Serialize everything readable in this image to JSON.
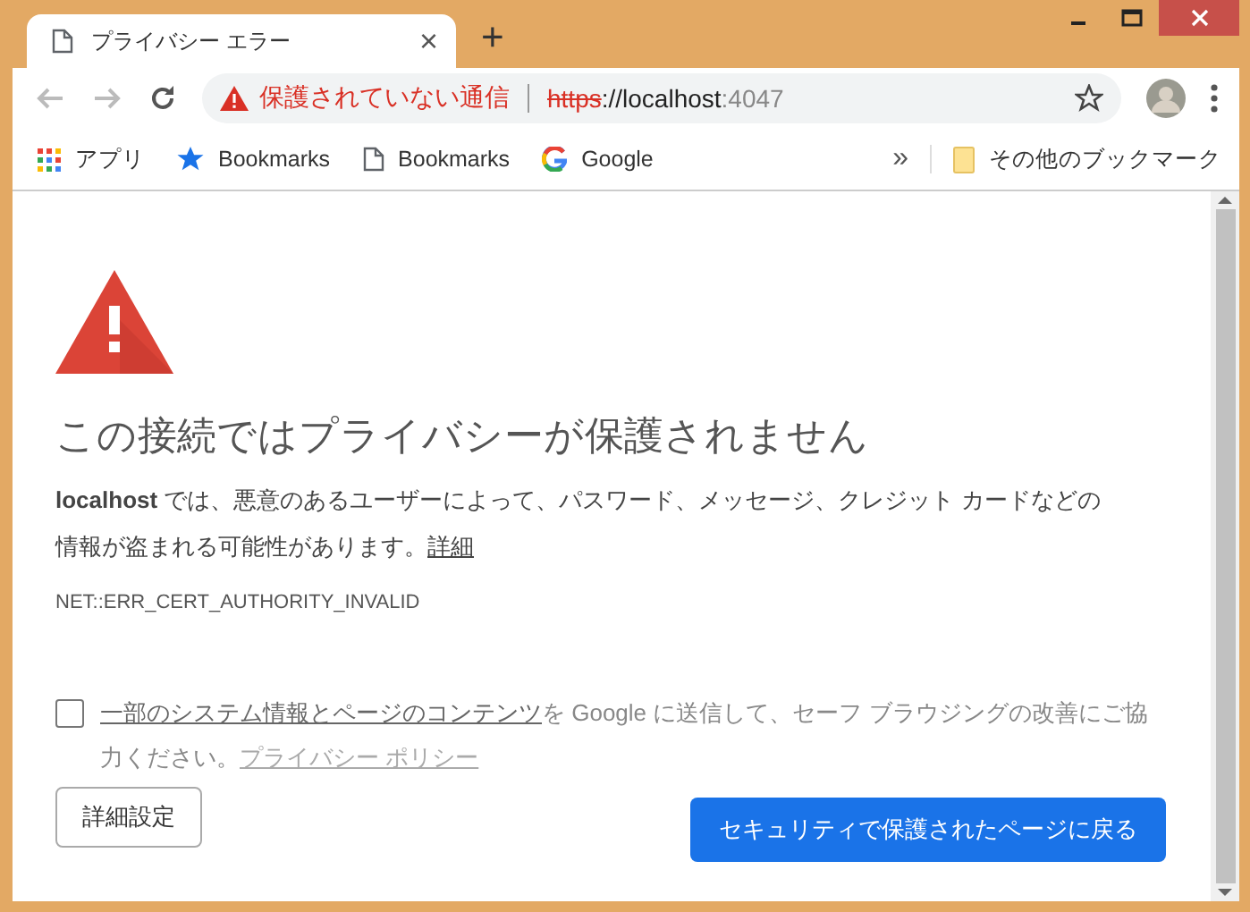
{
  "window": {
    "controls": [
      {
        "kind": "minimize"
      },
      {
        "kind": "maximize"
      },
      {
        "kind": "close"
      }
    ]
  },
  "tabs": [
    {
      "title": "プライバシー エラー",
      "close": "×",
      "selected": true
    }
  ],
  "new_tab": "+",
  "address_bar": {
    "security_label": "保護されていない通信",
    "url_scheme": "https",
    "url_host": "://localhost",
    "url_port": ":4047"
  },
  "bookmarks": [
    {
      "kind": "apps",
      "label": "アプリ"
    },
    {
      "kind": "star",
      "label": "Bookmarks"
    },
    {
      "kind": "page",
      "label": "Bookmarks"
    },
    {
      "kind": "google",
      "label": "Google"
    }
  ],
  "bookmarks_overflow": "»",
  "other_bookmarks": "その他のブックマーク",
  "page": {
    "title": "この接続ではプライバシーが保護されません",
    "description": "**localhost** では、悪意のあるユーザーによって、パスワード、メッセージ、クレジット カードなどの情報が盗まれる可能性があります。",
    "details_link": "詳細",
    "error_code": "NET::ERR_CERT_AUTHORITY_INVALID",
    "consent": {
      "checked": false,
      "link": "一部のシステム情報とページのコンテンツ",
      "text": "を Google に送信して、セーフ ブラウジングの改善にご協力ください。",
      "policy_link": "プライバシー ポリシー"
    },
    "buttons": [
      {
        "kind": "secondary",
        "label": "詳細設定"
      },
      {
        "kind": "primary",
        "label": "セキュリティで保護されたページに戻る"
      }
    ]
  }
}
